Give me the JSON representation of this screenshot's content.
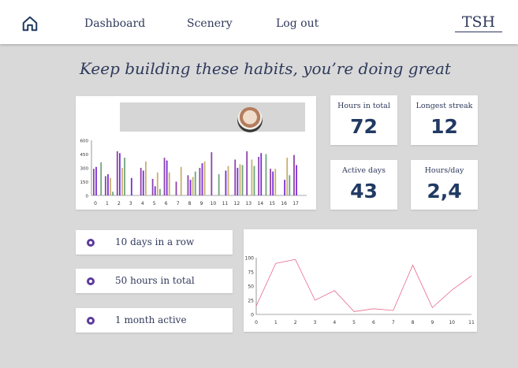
{
  "header": {
    "home_icon": "home-icon",
    "nav": [
      "Dashboard",
      "Scenery",
      "Log out"
    ],
    "brand": "TSH"
  },
  "headline": "Keep building these habits, you’re doing great",
  "stats": [
    {
      "label": "Hours in total",
      "value": "72"
    },
    {
      "label": "Longest streak",
      "value": "12"
    },
    {
      "label": "Active days",
      "value": "43"
    },
    {
      "label": "Hours/day",
      "value": "2,4"
    }
  ],
  "achievements": [
    {
      "text": "10 days in a row",
      "icon": "award-icon"
    },
    {
      "text": "50 hours in total",
      "icon": "award-icon"
    },
    {
      "text": "1 month active",
      "icon": "award-icon"
    }
  ],
  "chart_data": [
    {
      "type": "bar",
      "categories": [
        "0",
        "1",
        "2",
        "3",
        "4",
        "5",
        "6",
        "7",
        "8",
        "9",
        "10",
        "11",
        "12",
        "13",
        "14",
        "15",
        "16",
        "17"
      ],
      "ylim": [
        0,
        600
      ],
      "yticks": [
        0,
        150,
        300,
        450,
        600
      ],
      "series": [
        {
          "color": "#8e44ad",
          "values": [
            290,
            210,
            480,
            0,
            300,
            180,
            410,
            150,
            220,
            300,
            470,
            0,
            390,
            480,
            420,
            290,
            0,
            440
          ]
        },
        {
          "color": "#7b2fd6",
          "values": [
            310,
            230,
            460,
            190,
            270,
            100,
            380,
            0,
            170,
            350,
            0,
            270,
            300,
            0,
            460,
            260,
            170,
            330
          ]
        },
        {
          "color": "#c9b06e",
          "values": [
            0,
            190,
            300,
            0,
            370,
            250,
            250,
            310,
            200,
            370,
            0,
            320,
            340,
            390,
            0,
            290,
            410,
            0
          ]
        },
        {
          "color": "#6fa57c",
          "values": [
            360,
            40,
            410,
            0,
            0,
            70,
            0,
            0,
            260,
            0,
            230,
            0,
            330,
            320,
            450,
            0,
            220,
            0
          ]
        }
      ]
    },
    {
      "type": "line",
      "x": [
        0,
        1,
        2,
        3,
        4,
        5,
        6,
        7,
        8,
        9,
        10,
        11
      ],
      "values": [
        15,
        90,
        97,
        25,
        42,
        5,
        10,
        7,
        87,
        12,
        43,
        68
      ],
      "ylim": [
        0,
        100
      ],
      "yticks": [
        0,
        25,
        50,
        75,
        100
      ],
      "color": "#e86a8c"
    }
  ]
}
